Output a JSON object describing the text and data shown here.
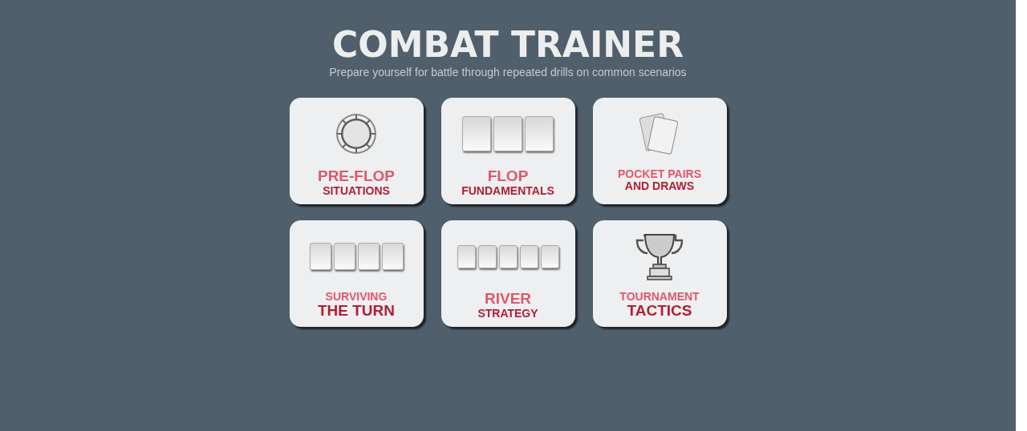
{
  "header": {
    "title": "COMBAT TRAINER",
    "subtitle": "Prepare yourself for battle through repeated drills on common scenarios"
  },
  "cards": [
    {
      "kind": "chip",
      "lines": [
        {
          "text": "PRE-FLOP",
          "emphasis": true
        },
        {
          "text": "SITUATIONS",
          "emphasis": false
        }
      ]
    },
    {
      "kind": "flop-cards",
      "lines": [
        {
          "text": "FLOP",
          "emphasis": true
        },
        {
          "text": "FUNDAMENTALS",
          "emphasis": false
        }
      ]
    },
    {
      "kind": "pocket-pair",
      "lines": [
        {
          "text": "POCKET PAIRS",
          "emphasis": false
        },
        {
          "text": "AND DRAWS",
          "emphasis": false
        }
      ]
    },
    {
      "kind": "turn-cards",
      "lines": [
        {
          "text": "SURVIVING",
          "emphasis": false
        },
        {
          "text": "THE TURN",
          "emphasis": true
        }
      ]
    },
    {
      "kind": "river-cards",
      "lines": [
        {
          "text": "RIVER",
          "emphasis": true
        },
        {
          "text": "STRATEGY",
          "emphasis": false
        }
      ]
    },
    {
      "kind": "trophy",
      "lines": [
        {
          "text": "TOURNAMENT",
          "emphasis": false
        },
        {
          "text": "TACTICS",
          "emphasis": true
        }
      ]
    }
  ]
}
